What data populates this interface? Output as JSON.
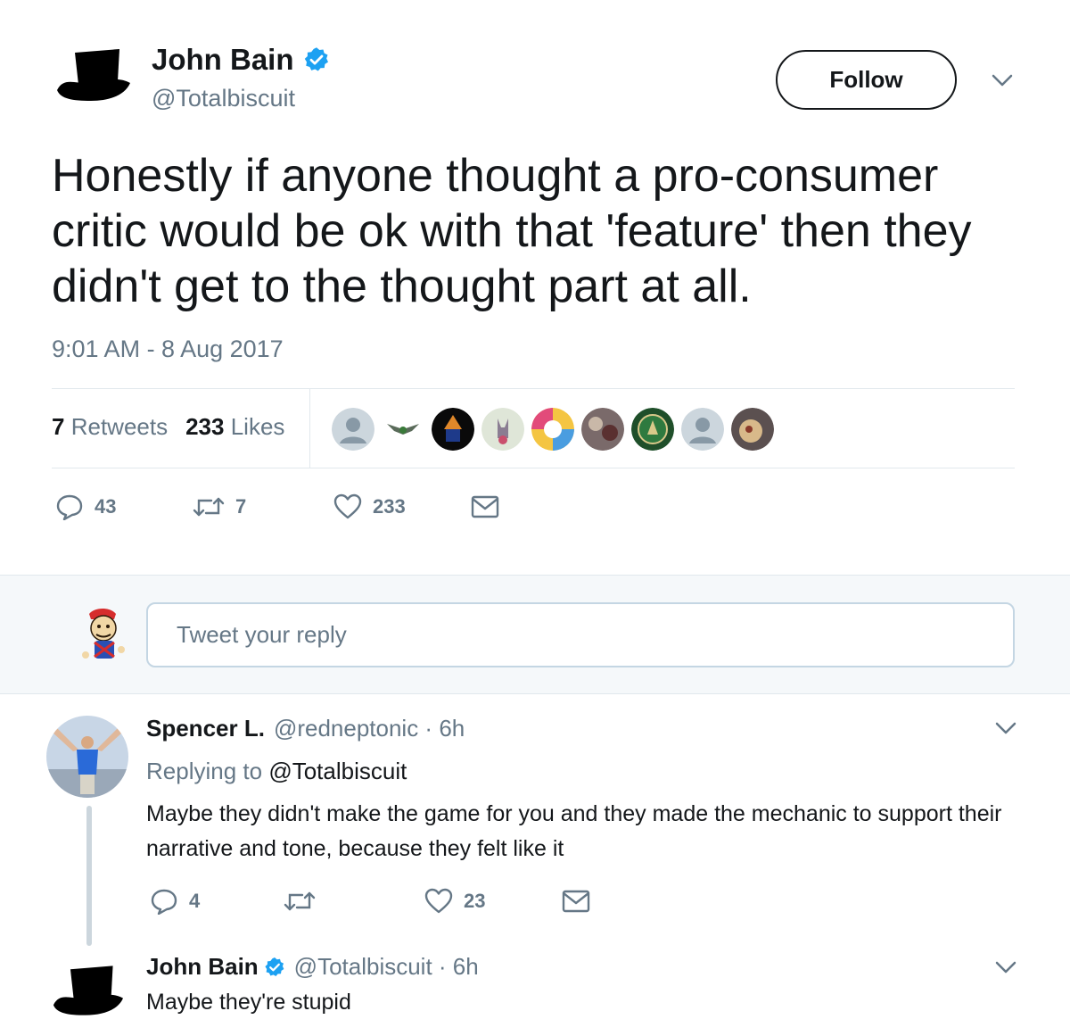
{
  "tweet": {
    "author_name": "John Bain",
    "author_handle": "@Totalbiscuit",
    "follow_label": "Follow",
    "text": "Honestly if anyone thought a pro-consumer critic would be ok with that 'feature' then they didn't get to the thought part at all.",
    "timestamp": "9:01 AM - 8 Aug 2017",
    "retweets_count": "7",
    "retweets_label": "Retweets",
    "likes_count": "233",
    "likes_label": "Likes",
    "actions": {
      "reply_count": "43",
      "retweet_count": "7",
      "like_count": "233"
    }
  },
  "reply_box": {
    "placeholder": "Tweet your reply"
  },
  "replies": [
    {
      "name": "Spencer L.",
      "handle_time": "@redneptonic · 6h",
      "replying_prefix": "Replying to",
      "replying_to": "@Totalbiscuit",
      "text": "Maybe they didn't make the game for you and they made the mechanic to support their narrative and tone, because they felt like it",
      "reply_count": "4",
      "retweet_count": "",
      "like_count": "23"
    },
    {
      "name": "John Bain",
      "handle_time": "@Totalbiscuit · 6h",
      "text": "Maybe they're stupid"
    }
  ],
  "colors": {
    "text": "#14171a",
    "muted": "#657786",
    "verified": "#1da1f2",
    "border": "#e1e8ed",
    "band": "#f5f8fa"
  },
  "icons": [
    "top-hat-icon",
    "verified-badge-icon",
    "chevron-down-icon",
    "reply-icon",
    "retweet-icon",
    "heart-icon",
    "message-icon"
  ]
}
